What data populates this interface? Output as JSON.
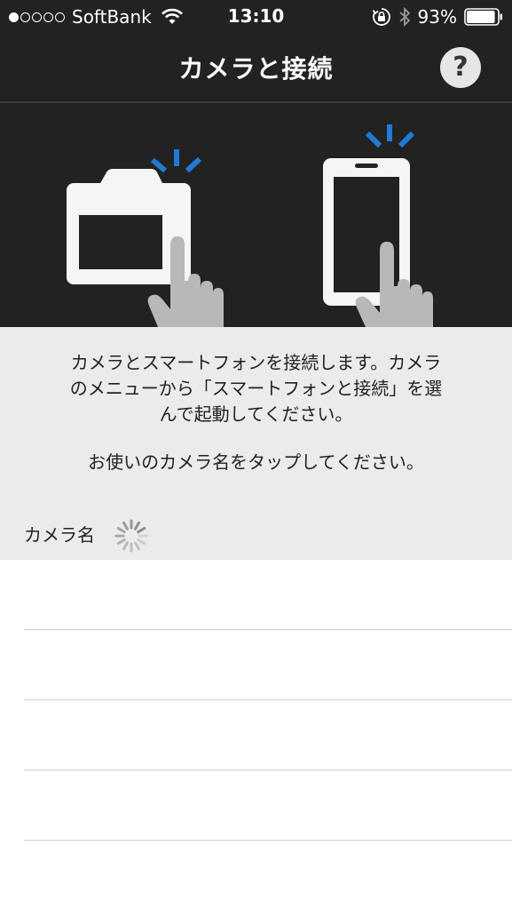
{
  "status_bar": {
    "carrier": "SoftBank",
    "time": "13:10",
    "battery_percent": "93%",
    "battery_level": 0.93,
    "signal_bars_filled": 1,
    "signal_bars_total": 5,
    "icons": [
      "wifi-icon",
      "rotation-lock-icon",
      "bluetooth-icon",
      "battery-icon"
    ]
  },
  "nav": {
    "title": "カメラと接続",
    "help_label": "?"
  },
  "illustration": {
    "accent_color": "#1e7bd6",
    "icons": [
      "camera-icon",
      "smartphone-icon",
      "hand-pointer-icon"
    ]
  },
  "info": {
    "instruction_line1": "カメラとスマートフォンを接続します。カメラ",
    "instruction_line2": "のメニューから「スマートフォンと接続」を選",
    "instruction_line3": "んで起動してください。",
    "tap_instruction": "お使いのカメラ名をタップしてください。",
    "camera_name_header": "カメラ名"
  },
  "camera_list": {
    "rows": [
      "",
      "",
      "",
      ""
    ]
  }
}
